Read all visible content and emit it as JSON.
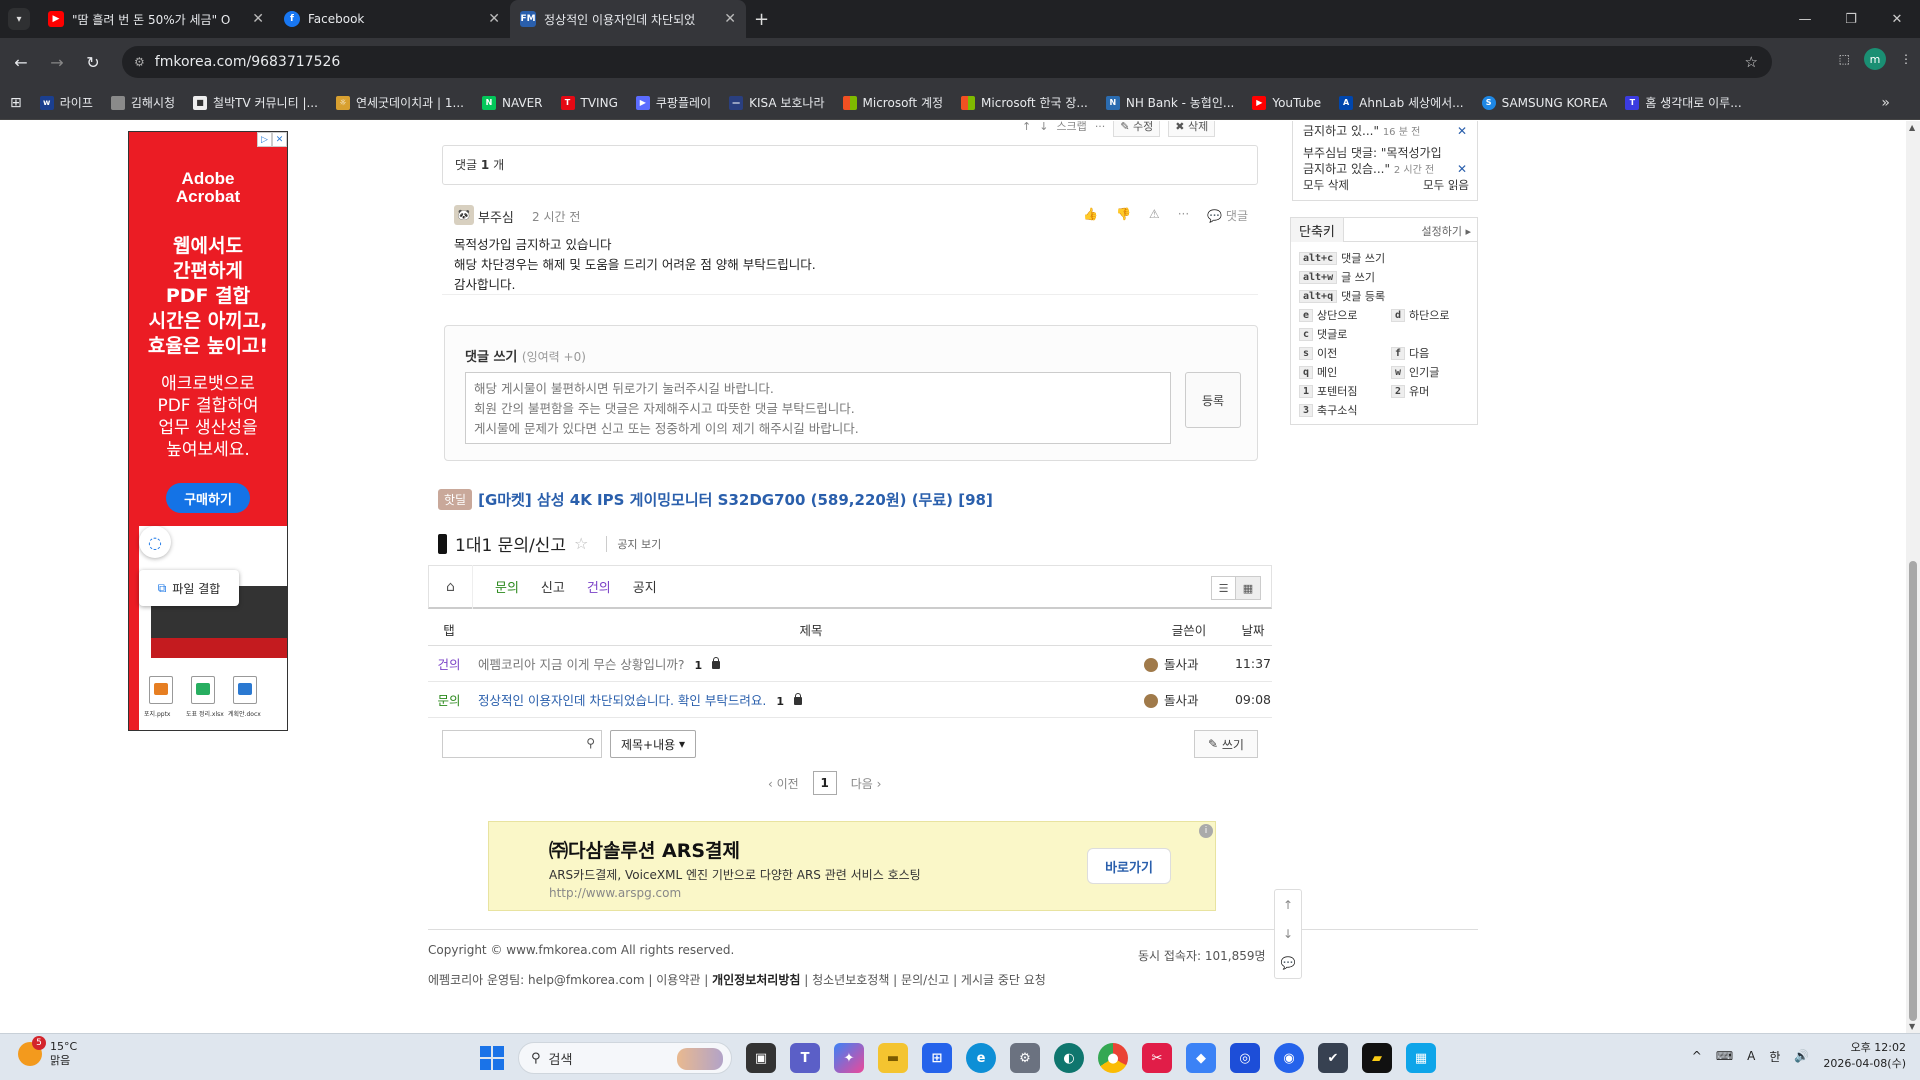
{
  "browser": {
    "tabs": [
      {
        "title": "\"땀 흘려 번 돈 50%가 세금\" O",
        "favicon": "youtube-icon",
        "active": false
      },
      {
        "title": "Facebook",
        "favicon": "facebook-icon",
        "active": false
      },
      {
        "title": "정상적인 이용자인데 차단되었",
        "favicon": "fmkorea-icon",
        "active": true
      }
    ],
    "url": "fmkorea.com/9683717526",
    "profile_initial": "m",
    "bookmarks": [
      "라이프",
      "김해시청",
      "철박TV 커뮤니티 |...",
      "연세굿데이치과 | 1...",
      "NAVER",
      "TVING",
      "쿠팡플레이",
      "KISA 보호나라",
      "Microsoft 계정",
      "Microsoft 한국 장...",
      "NH Bank - 농협인...",
      "YouTube",
      "AhnLab 세상에서...",
      "SAMSUNG KOREA",
      "홈 생각대로 이루..."
    ]
  },
  "ad_left": {
    "brand": "Adobe\nAcrobat",
    "headline": "웹에서도\n간편하게\nPDF 결합\n시간은 아끼고,\n효율은 높이고!",
    "sub": "애크로뱃으로\nPDF 결합하여\n업무 생산성을\n높여보세요.",
    "buy": "구매하기",
    "merge": "파일 결합",
    "files": [
      "포지.pptx",
      "도표 정리.xlsx",
      "계획안.docx"
    ]
  },
  "article_toolbar": {
    "scrap": "스크랩",
    "edit": "수정",
    "delete": "삭제"
  },
  "comments": {
    "header_label": "댓글",
    "count": "1",
    "count_unit": "개",
    "items": [
      {
        "author": "부주심",
        "time": "2 시간 전",
        "reply_label": "댓글",
        "lines": [
          "목적성가입 금지하고 있습니다",
          "해당 차단경우는 해제 및 도움을 드리기 어려운 점 양해 부탁드립니다.",
          "감사합니다."
        ]
      }
    ],
    "write_label": "댓글 쓰기",
    "surplus": "(잉여력 +0)",
    "placeholder_lines": [
      "해당 게시물이 불편하시면 뒤로가기 눌러주시길 바랍니다.",
      "회원 간의 불편함을 주는 댓글은 자제해주시고 따뜻한 댓글 부탁드립니다.",
      "게시물에 문제가 있다면 신고 또는 정중하게 이의 제기 해주시길 바랍니다."
    ],
    "submit": "등록"
  },
  "hotdeal": {
    "badge": "핫딜",
    "text": "[G마켓] 삼성 4K IPS 게이밍모니터 S32DG700 (589,220원) (무료) [98]"
  },
  "board": {
    "title": "1대1 문의/신고",
    "notice_link": "공지 보기",
    "tabs": [
      {
        "label": "문의",
        "color": "#2d8a1e"
      },
      {
        "label": "신고",
        "color": "#333333"
      },
      {
        "label": "건의",
        "color": "#7b42c7"
      },
      {
        "label": "공지",
        "color": "#333333"
      }
    ],
    "columns": {
      "tab": "탭",
      "title": "제목",
      "author": "글쓴이",
      "date": "날짜"
    },
    "rows": [
      {
        "tab": "건의",
        "title": "에펨코리아 지금 이게 무슨 상황입니까?",
        "count": "1",
        "author": "돌사과",
        "date": "11:37"
      },
      {
        "tab": "문의",
        "title": "정상적인 이용자인데 차단되었습니다. 확인 부탁드려요.",
        "count": "1",
        "author": "돌사과",
        "date": "09:08"
      }
    ],
    "search_select": "제목+내용",
    "write": "쓰기",
    "pager": {
      "prev": "‹ 이전",
      "current": "1",
      "next": "다음 ›"
    }
  },
  "ad_bottom": {
    "headline": "㈜다삼솔루션 ARS결제",
    "desc": "ARS카드결제, VoiceXML 엔진 기반으로 다양한 ARS 관련 서비스 호스팅",
    "url": "http://www.arspg.com",
    "cta": "바로가기"
  },
  "footer": {
    "copyright": "Copyright © www.fmkorea.com All rights reserved.",
    "online": "동시 접속자: 101,859명",
    "operator": "에펨코리아 운영팀: help@fmkorea.com",
    "links": [
      "이용약관",
      "개인정보처리방침",
      "청소년보호정책",
      "문의/신고",
      "게시글 중단 요청"
    ]
  },
  "sidebar": {
    "notif1": "금지하고 있...\"",
    "notif1_time": "16 분 전",
    "notif2_a": "부주심님 댓글: \"목적성가입",
    "notif2_b": "금지하고 있슴...\"",
    "notif2_time": "2 시간 전",
    "delete_all": "모두 삭제",
    "read_all": "모두 읽음",
    "shortcut_title": "단축키",
    "shortcut_settings": "설정하기",
    "shortcuts": [
      {
        "key": "alt+c",
        "label": "댓글 쓰기"
      },
      {
        "key": "alt+w",
        "label": "글 쓰기"
      },
      {
        "key": "alt+q",
        "label": "댓글 등록"
      },
      {
        "key": "e",
        "label": "상단으로"
      },
      {
        "key": "d",
        "label": "하단으로"
      },
      {
        "key": "c",
        "label": "댓글로"
      },
      {
        "key": "s",
        "label": "이전"
      },
      {
        "key": "f",
        "label": "다음"
      },
      {
        "key": "q",
        "label": "메인"
      },
      {
        "key": "w",
        "label": "인기글"
      },
      {
        "key": "1",
        "label": "포텐터짐"
      },
      {
        "key": "2",
        "label": "유머"
      },
      {
        "key": "3",
        "label": "축구소식"
      }
    ]
  },
  "taskbar": {
    "weather_temp": "15°C",
    "weather_desc": "맑음",
    "weather_badge": "5",
    "search": "검색",
    "ime_a": "A",
    "ime_han": "한",
    "time": "오후 12:02",
    "date": "2026-04-08(수)"
  }
}
